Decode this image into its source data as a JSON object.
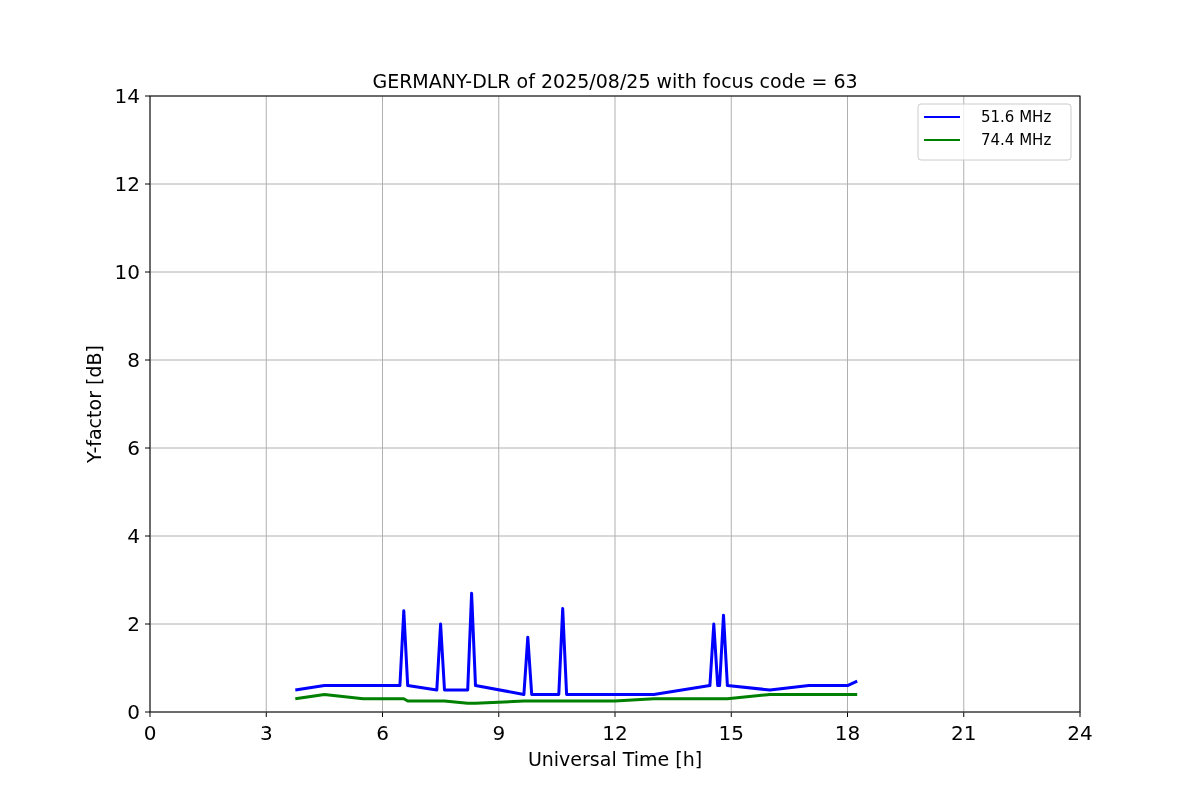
{
  "chart_data": {
    "type": "line",
    "title": "GERMANY-DLR of 2025/08/25 with focus code = 63",
    "xlabel": "Universal Time [h]",
    "ylabel": "Y-factor [dB]",
    "x": [
      3.75,
      4.5,
      5.5,
      6.45,
      6.55,
      6.65,
      7.4,
      7.5,
      7.6,
      8.2,
      8.3,
      8.4,
      9.65,
      9.75,
      9.85,
      10.55,
      10.65,
      10.75,
      12,
      13,
      14.45,
      14.55,
      14.65,
      14.7,
      14.8,
      14.9,
      16,
      17,
      18,
      18.25
    ],
    "series": [
      {
        "name": "51.6 MHz",
        "color": "#0000ff",
        "values": [
          0.5,
          0.6,
          0.6,
          0.6,
          2.3,
          0.6,
          0.5,
          2.0,
          0.5,
          0.5,
          2.7,
          0.6,
          0.4,
          1.7,
          0.4,
          0.4,
          2.35,
          0.4,
          0.4,
          0.4,
          0.6,
          2.0,
          0.6,
          0.6,
          2.2,
          0.6,
          0.5,
          0.6,
          0.6,
          0.7
        ]
      },
      {
        "name": "74.4 MHz",
        "color": "#008000",
        "values": [
          0.3,
          0.4,
          0.3,
          0.3,
          0.3,
          0.25,
          0.25,
          0.25,
          0.25,
          0.2,
          0.2,
          0.2,
          0.25,
          0.25,
          0.25,
          0.25,
          0.25,
          0.25,
          0.25,
          0.3,
          0.3,
          0.3,
          0.3,
          0.3,
          0.3,
          0.3,
          0.4,
          0.4,
          0.4,
          0.4
        ]
      }
    ],
    "grid": true,
    "legend": true,
    "xlim": [
      0,
      24
    ],
    "ylim": [
      0,
      14
    ],
    "xticks": [
      0,
      3,
      6,
      9,
      12,
      15,
      18,
      21,
      24
    ],
    "yticks": [
      0,
      2,
      4,
      6,
      8,
      10,
      12,
      14
    ]
  }
}
